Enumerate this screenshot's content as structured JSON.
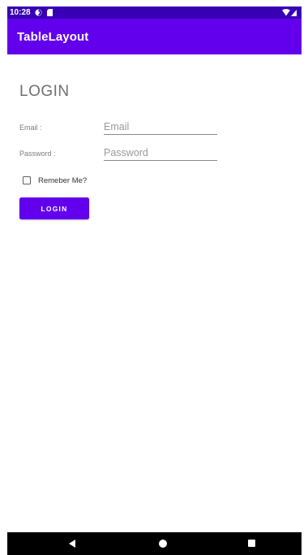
{
  "status_bar": {
    "time": "10:28",
    "icons": [
      "app-notification-icon",
      "sd-card-icon",
      "wifi-icon",
      "cell-signal-icon"
    ],
    "background_color": "#3700b3"
  },
  "app_bar": {
    "title": "TableLayout",
    "background_color": "#6200ee"
  },
  "login_form": {
    "heading": "LOGIN",
    "email_label": "Email :",
    "email_placeholder": "Email",
    "email_value": "",
    "password_label": "Password :",
    "password_placeholder": "Password",
    "password_value": "",
    "remember_label": "Remeber Me?",
    "remember_checked": false,
    "login_button_label": "LOGIN",
    "accent_color": "#6200ee"
  },
  "nav_bar": {
    "icons": [
      "back-icon",
      "home-icon",
      "recents-icon"
    ]
  }
}
